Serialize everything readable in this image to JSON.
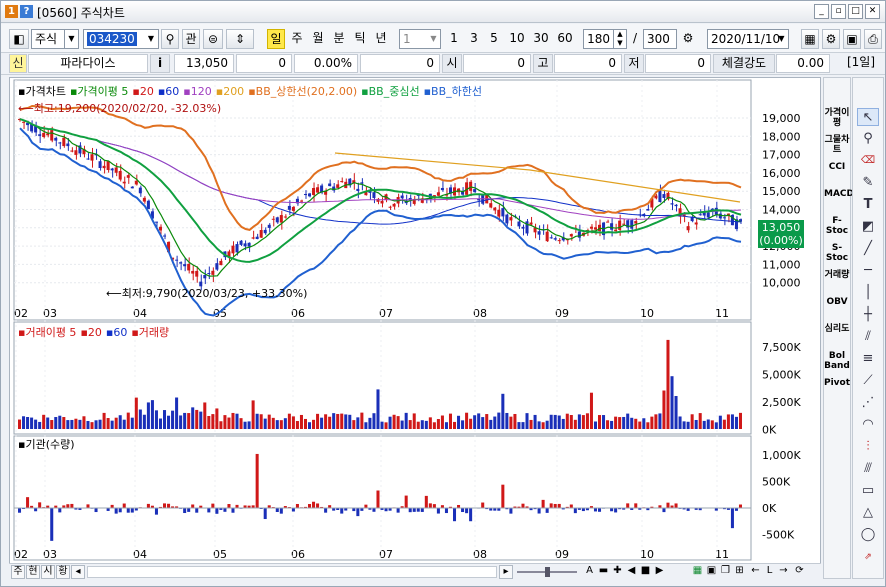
{
  "window": {
    "badge1": "1",
    "badge2": "?",
    "title": "[0560] 주식차트"
  },
  "toolbar": {
    "market_select": "주식",
    "code_input": "034230",
    "btn_gwan": "관",
    "period_buttons": [
      "일",
      "주",
      "월",
      "분",
      "틱",
      "년"
    ],
    "interval_select": "1",
    "interval_buttons": [
      "1",
      "3",
      "5",
      "10",
      "30",
      "60"
    ],
    "count_value": "180",
    "slash": "/",
    "total_value": "300",
    "date_value": "2020/11/10"
  },
  "quote": {
    "tag": "신",
    "name": "파라다이스",
    "info": "i",
    "price": "13,050",
    "change": "0",
    "change_rate": "0.00%",
    "volume": "0",
    "open_label": "시",
    "open_value": "0",
    "high_label": "고",
    "high_value": "0",
    "low_label": "저",
    "low_value": "0",
    "strength_label": "체결강도",
    "strength_value": "0.00",
    "period_tag": "[1일]"
  },
  "price_panel": {
    "legend": [
      {
        "text": "가격차트",
        "color": "#000000"
      },
      {
        "text": "가격이평 5",
        "color": "#0a8a0a"
      },
      {
        "text": "20",
        "color": "#d01818"
      },
      {
        "text": "60",
        "color": "#1030c8"
      },
      {
        "text": "120",
        "color": "#a040c0"
      },
      {
        "text": "200",
        "color": "#e0a020"
      },
      {
        "text": "BB_상한선(20,2.00)",
        "color": "#e07020"
      },
      {
        "text": "BB_중심선",
        "color": "#10a040"
      },
      {
        "text": "BB_하한선",
        "color": "#2060d0"
      }
    ],
    "high_note": "최고:19,200(2020/02/20, -32.03%)",
    "low_note": "최저:9,790(2020/03/23, +33.30%)",
    "y_ticks": [
      "19,000",
      "18,000",
      "17,000",
      "16,000",
      "15,000",
      "14,000",
      "13,000",
      "12,000",
      "11,000",
      "10,000"
    ],
    "last_price": "13,050",
    "last_rate": "(0.00%)"
  },
  "volume_panel": {
    "legend": [
      {
        "text": "거래이평 5",
        "color": "#d01818"
      },
      {
        "text": "20",
        "color": "#d01818"
      },
      {
        "text": "60",
        "color": "#1030c8"
      },
      {
        "text": "거래량",
        "color": "#d01818"
      }
    ],
    "y_ticks": [
      "7,500K",
      "5,000K",
      "2,500K",
      "0K"
    ]
  },
  "inst_panel": {
    "legend": [
      {
        "text": "기관(수량)",
        "color": "#000000"
      }
    ],
    "y_ticks": [
      "1,000K",
      "500K",
      "0K",
      "-500K"
    ]
  },
  "x_labels": [
    "02",
    "03",
    "04",
    "05",
    "06",
    "07",
    "08",
    "09",
    "10",
    "11"
  ],
  "indicators": [
    "가격이평",
    "그물차트",
    "CCI",
    "MACD",
    "F-Stoc",
    "S-Stoc",
    "거래량",
    "OBV",
    "심리도",
    "Bol Band",
    "Pivot"
  ],
  "bottom_tabs": [
    "주",
    "현",
    "시",
    "황"
  ],
  "colors": {
    "up": "#d01818",
    "down": "#1a2fb8",
    "accent": "#1a57c8"
  }
}
